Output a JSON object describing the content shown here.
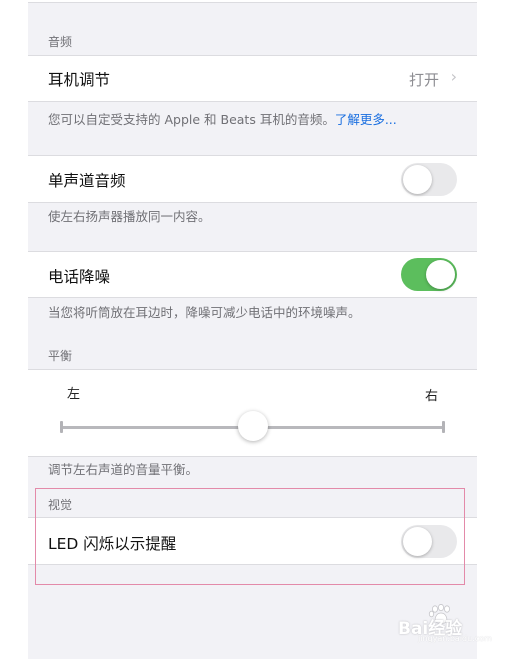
{
  "audio_section": {
    "header": "音频",
    "headphone_row": {
      "label": "耳机调节",
      "value": "打开",
      "chevron": "chevron-right-icon"
    },
    "headphone_footer_text": "您可以自定受支持的 Apple 和 Beats 耳机的音频。",
    "headphone_footer_link": "了解更多...",
    "mono_row": {
      "label": "单声道音频",
      "toggle_on": false
    },
    "mono_footer": "使左右扬声器播放同一内容。",
    "noise_row": {
      "label": "电话降噪",
      "toggle_on": true
    },
    "noise_footer": "当您将听筒放在耳边时，降噪可减少电话中的环境噪声。"
  },
  "balance_section": {
    "header": "平衡",
    "left_label": "左",
    "right_label": "右",
    "balance_value": 0.5,
    "footer": "调节左右声道的音量平衡。"
  },
  "visual_section": {
    "header": "视觉",
    "led_row": {
      "label": "LED 闪烁以示提醒",
      "toggle_on": false
    }
  },
  "watermark": {
    "text": "Bai经验",
    "domain": "jingyan.baidu.com"
  },
  "colors": {
    "toggle_on": "#5cbe5d",
    "toggle_off": "#e9e9eb",
    "link": "#1a6fe0",
    "highlight_border": "#e38aa9",
    "group_background": "#f2f2f6"
  }
}
